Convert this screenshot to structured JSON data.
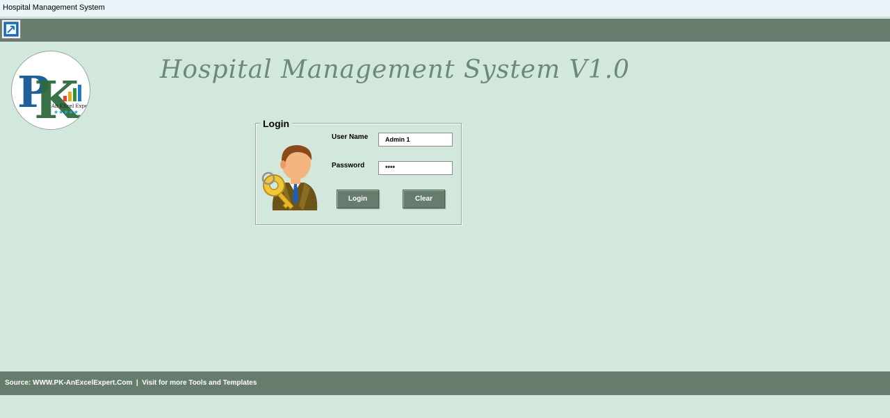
{
  "window": {
    "title": "Hospital Management System"
  },
  "app": {
    "title": "Hospital Management System V1.0"
  },
  "logo": {
    "letters": "PK",
    "tagline": "An EXcel Expert",
    "stars": "★★★★★"
  },
  "login": {
    "legend": "Login",
    "username_label": "User Name",
    "username_value": "Admin 1",
    "password_label": "Password",
    "password_value": "****",
    "login_button": "Login",
    "clear_button": "Clear"
  },
  "footer": {
    "text": "Source: WWW.PK-AnExcelExpert.Com  |  Visit for more Tools and Templates"
  },
  "colors": {
    "background": "#d3e8dc",
    "bar": "#667d6d",
    "title": "#6b8a76"
  }
}
